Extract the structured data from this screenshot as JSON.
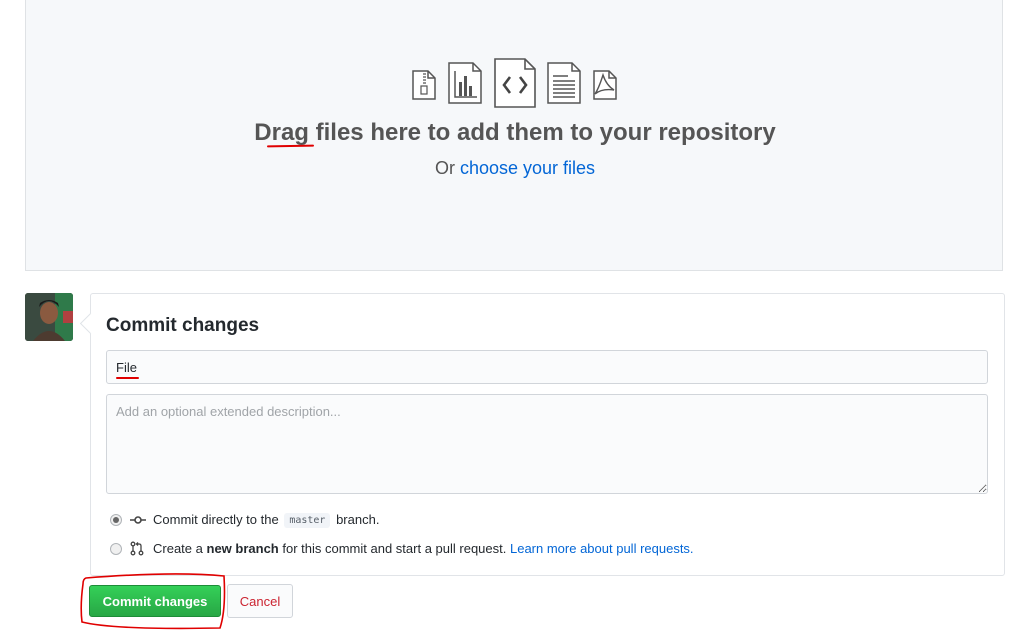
{
  "dropzone": {
    "title": "Drag files here to add them to your repository",
    "or_label": "Or",
    "choose_link": "choose your files",
    "icons": [
      "zip-file-icon",
      "chart-file-icon",
      "code-file-icon",
      "text-file-icon",
      "pdf-file-icon"
    ]
  },
  "commit": {
    "heading": "Commit changes",
    "summary_value": "File",
    "description_placeholder": "Add an optional extended description...",
    "option_direct": {
      "prefix": "Commit directly to the",
      "branch": "master",
      "suffix": "branch.",
      "checked": true
    },
    "option_new_branch": {
      "prefix": "Create a",
      "bold": "new branch",
      "suffix": "for this commit and start a pull request.",
      "link": "Learn more about pull requests.",
      "checked": false
    },
    "commit_button": "Commit changes",
    "cancel_button": "Cancel"
  },
  "colors": {
    "commit_green": "#28a745",
    "cancel_red": "#cb2431",
    "link_blue": "#0366d6",
    "annotation_red": "#e00000"
  }
}
